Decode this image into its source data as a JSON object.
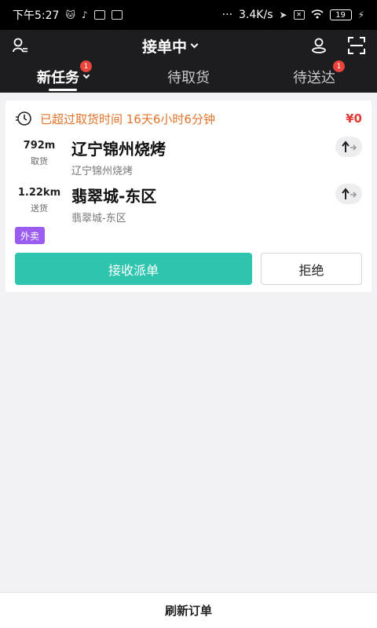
{
  "status_bar": {
    "time": "下午5:27",
    "more": "···",
    "network_speed": "3.4K/s",
    "battery": "19"
  },
  "header": {
    "title": "接单中"
  },
  "tabs": [
    {
      "label": "新任务",
      "badge": "1",
      "active": true
    },
    {
      "label": "待取货",
      "badge": "",
      "active": false
    },
    {
      "label": "待送达",
      "badge": "1",
      "active": false
    }
  ],
  "order": {
    "overdue_text": "已超过取货时间 16天6小时6分钟",
    "price": "¥0",
    "pickup": {
      "distance": "792m",
      "tag": "取货",
      "name": "辽宁锦州烧烤",
      "address": "辽宁锦州烧烤"
    },
    "delivery": {
      "distance": "1.22km",
      "tag": "送货",
      "name": "翡翠城-东区",
      "address": "翡翠城-东区"
    },
    "category_tag": "外卖",
    "accept_label": "接收派单",
    "reject_label": "拒绝"
  },
  "bottom": {
    "refresh_label": "刷新订单"
  },
  "colors": {
    "accent": "#2ec4ae",
    "warning": "#e0732b",
    "price": "#e53935",
    "tag": "#9b5cf0",
    "badge": "#e8443b",
    "header_bg": "#1d1d20"
  }
}
